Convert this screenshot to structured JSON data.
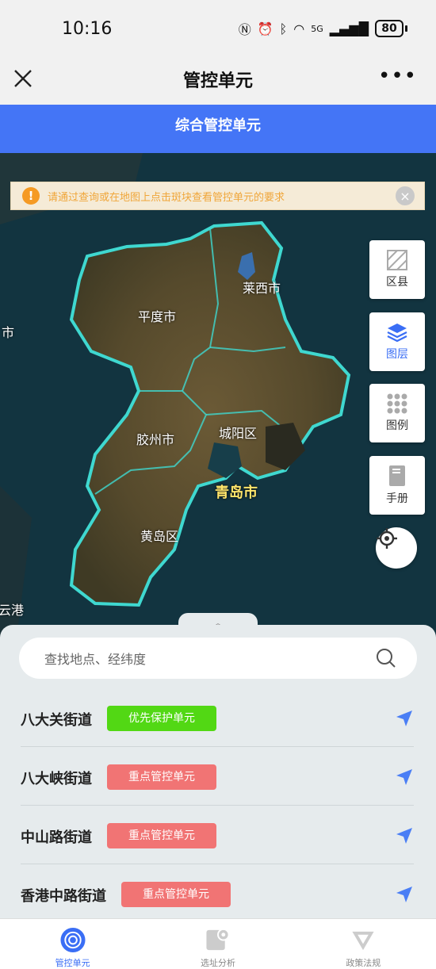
{
  "status": {
    "time": "10:16",
    "network": "5G",
    "battery": "80"
  },
  "titlebar": {
    "title": "管控单元"
  },
  "banner": {
    "text": "综合管控单元"
  },
  "notice": {
    "text": "请通过查询或在地图上点击斑块查看管控单元的要求"
  },
  "map": {
    "labels": {
      "laixi": "莱西市",
      "pingdu": "平度市",
      "jiaozhou": "胶州市",
      "chengyang": "城阳区",
      "qingdao": "青岛市",
      "huangdao": "黄岛区",
      "west_edge": "市",
      "sw_edge": "云港"
    }
  },
  "tools": [
    {
      "label": "区县",
      "icon": "hatch-icon"
    },
    {
      "label": "图层",
      "icon": "layers-icon"
    },
    {
      "label": "图例",
      "icon": "grid-icon"
    },
    {
      "label": "手册",
      "icon": "book-icon"
    }
  ],
  "search": {
    "placeholder": "查找地点、经纬度"
  },
  "units": [
    {
      "name": "八大关街道",
      "badge": "优先保护单元",
      "color": "#52d814"
    },
    {
      "name": "八大峡街道",
      "badge": "重点管控单元",
      "color": "#f17474"
    },
    {
      "name": "中山路街道",
      "badge": "重点管控单元",
      "color": "#f17474"
    },
    {
      "name": "香港中路街道",
      "badge": "重点管控单元",
      "color": "#f17474"
    }
  ],
  "nav": [
    {
      "label": "管控单元",
      "active": true
    },
    {
      "label": "选址分析",
      "active": false
    },
    {
      "label": "政策法规",
      "active": false
    }
  ],
  "colors": {
    "accent": "#4475f6",
    "outline": "#3fd8d0"
  }
}
